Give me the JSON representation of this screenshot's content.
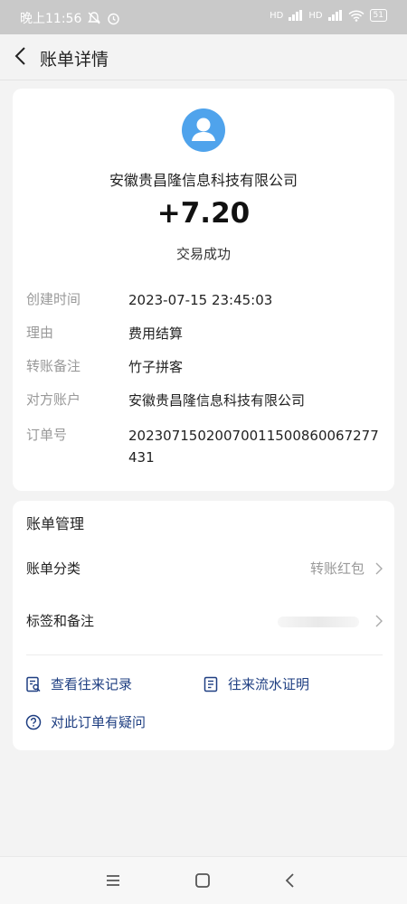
{
  "status_bar": {
    "time": "晚上11:56",
    "signal1": "HD",
    "signal2": "HD",
    "battery": "51"
  },
  "header": {
    "title": "账单详情"
  },
  "transaction": {
    "merchant": "安徽贵昌隆信息科技有限公司",
    "amount": "+7.20",
    "status": "交易成功"
  },
  "details": [
    {
      "key": "创建时间",
      "value": "2023-07-15 23:45:03"
    },
    {
      "key": "理由",
      "value": "费用结算"
    },
    {
      "key": "转账备注",
      "value": "竹子拼客"
    },
    {
      "key": "对方账户",
      "value": "安徽贵昌隆信息科技有限公司"
    },
    {
      "key": "订单号",
      "value": "20230715020070011500860067277431"
    }
  ],
  "management": {
    "title": "账单管理",
    "category_label": "账单分类",
    "category_value": "转账红包",
    "tags_label": "标签和备注",
    "links": {
      "history": "查看往来记录",
      "proof": "往来流水证明",
      "question": "对此订单有疑问"
    }
  },
  "colors": {
    "accent": "#4fa3ec",
    "link": "#1f3f82",
    "muted": "#999999"
  }
}
